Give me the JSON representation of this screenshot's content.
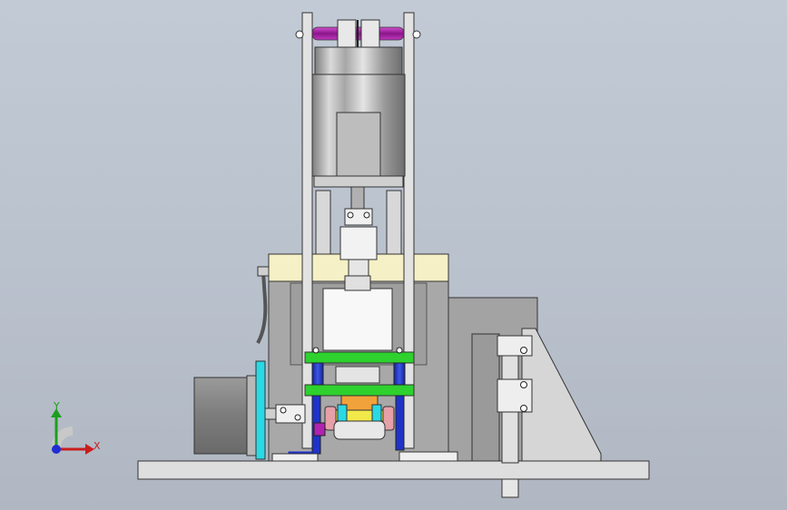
{
  "viewport": {
    "background_top": "#c2cad6",
    "background_bottom": "#b0b7c2"
  },
  "triad": {
    "y_label": "Y",
    "x_label": "X",
    "y_color": "#1e9e1e",
    "x_color": "#c81e1e",
    "z_color": "#1e2ed2"
  },
  "colors": {
    "frame": "#dcdcdc",
    "housing": "#a9a9a9",
    "motor_silver": "#b4b4b4",
    "cream_plate": "#f7f2c8",
    "green_plate": "#2ed12e",
    "blue_column": "#1f33c8",
    "magenta_roller": "#b023b0",
    "cyan_plate": "#29d9e6",
    "orange_part": "#f2a23a",
    "yellow_part": "#f2e84a",
    "pink_roller": "#e6a0a8",
    "dark_motor": "#8a8a8a"
  }
}
